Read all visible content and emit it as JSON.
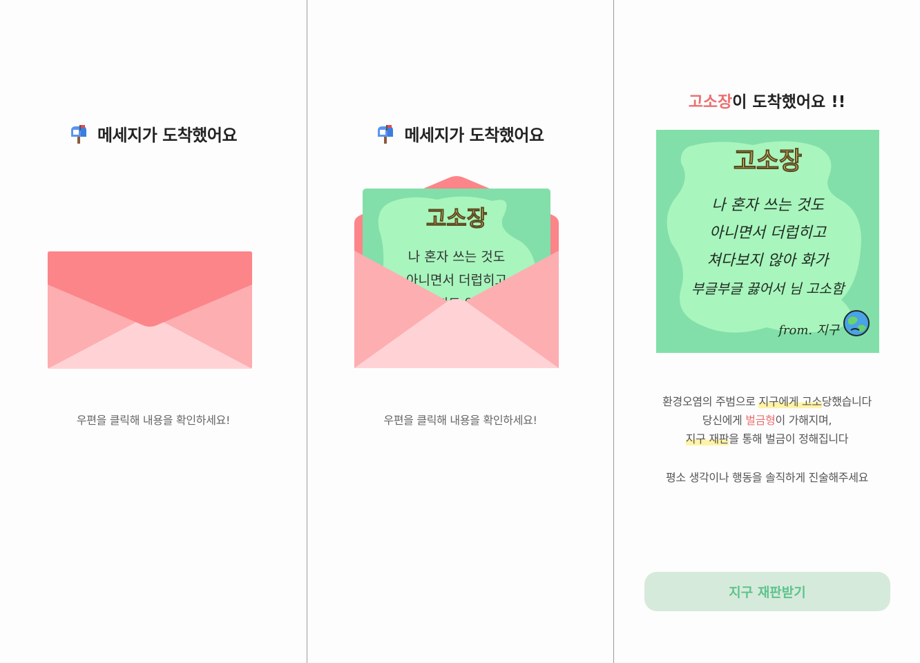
{
  "screen1": {
    "title": "메세지가 도착했어요",
    "hint": "우편을 클릭해 내용을 확인하세요!"
  },
  "screen2": {
    "title": "메세지가 도착했어요",
    "hint": "우편을 클릭해 내용을 확인하세요!",
    "card_title": "고소장",
    "card_line1": "나 혼자 쓰는 것도",
    "card_line2": "아니면서 더럽히고",
    "card_line3": "보지도 않아"
  },
  "screen3": {
    "title_accent": "고소장",
    "title_rest": "이 도착했어요 !!",
    "card_title": "고소장",
    "card_lines": [
      "나 혼자 쓰는 것도",
      "아니면서 더럽히고",
      "쳐다보지 않아 화가",
      "부글부글 끓어서 님 고소함"
    ],
    "card_from": "from. 지구",
    "desc_part1": "환경오염의 주범으로 ",
    "desc_hl1": "지구에게 고소",
    "desc_part2": "당했습니다",
    "desc_line2a": "당신에게 ",
    "desc_line2_red": "벌금형",
    "desc_line2b": "이 가해지며,",
    "desc_line3_hl": "지구 재판",
    "desc_line3b": "을 통해 벌금이 정해집니다",
    "desc2": "평소 생각이나 행동을 솔직하게 진술해주세요",
    "cta_label": "지구 재판받기"
  },
  "colors": {
    "envelope_flap": "#fc858a",
    "envelope_side": "#fdaeb1",
    "envelope_front": "#ffd3d5",
    "card_green": "#82dfa9",
    "card_blob": "#a8f5bd",
    "accent_red": "#ec6f6f",
    "cta_bg": "#d6eadc",
    "cta_text": "#5ec38c"
  },
  "icons": {
    "title_icon": "mailbox-with-mail-icon",
    "card_icon": "earth-icon"
  }
}
